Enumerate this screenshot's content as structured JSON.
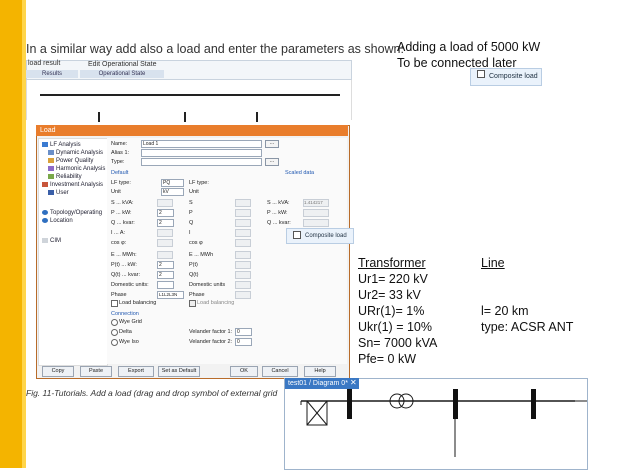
{
  "tutorial": {
    "heading": "In a similar way add also a load and enter the parameters as shown:",
    "mini_toolbar": {
      "result_label": "load result",
      "edit_state_label": "Edit Operational State",
      "tabs": [
        "Results",
        "Operational State"
      ]
    }
  },
  "notes": {
    "line1": "Adding a load of 5000 kW",
    "line2": "To be connected later",
    "composite_load_label": "Composite load"
  },
  "dialog": {
    "title": "Load",
    "tree": [
      "LF Analysis",
      "Dynamic Analysis",
      "Power Quality",
      "Harmonic Analysis",
      "Reliability",
      "Investment Analysis",
      "User",
      "Topology/Operating",
      "Location",
      "CIM"
    ],
    "fields": {
      "name_label": "Name:",
      "name_value": "Load 1",
      "alias_label": "Alias 1:",
      "type_label": "Type:",
      "default_header": "Default",
      "scaled_header": "Scaled data",
      "lf_type_label": "LF type:",
      "lf_type_value": "PQ",
      "unit_label": "Unit",
      "unit_value": "kV",
      "rows_left": [
        "S ... kVA:",
        "P ... kW:",
        "Q ... kvar:",
        "I ... A:",
        "cos φ:",
        "E ... MWh:",
        "P(t) ... kW:",
        "Q(t) ... kvar:",
        "Domestic units:",
        "Phase"
      ],
      "p_value": "2",
      "q_value": "2",
      "p_t_value": "2",
      "q_t_value": "2",
      "phase_value": "L1L2L3N",
      "rows_mid": [
        "S",
        "P",
        "Q",
        "I",
        "cos φ",
        "E ... MWh",
        "P(t)",
        "Q(t)",
        "Domestic units",
        "Phase"
      ],
      "rows_right": [
        "S ... kVA:",
        "P ... kW:",
        "Q ... kvar:"
      ],
      "scaled_value": "1.414217",
      "load_balancing_label": "Load balancing",
      "load_balancing_mid": "Load balancing",
      "connection_header": "Connection",
      "conn_options": [
        "Wye Grid",
        "Delta",
        "Wye Iso"
      ],
      "velander1_label": "Velander factor 1:",
      "velander1_value": "0",
      "velander2_label": "Velander factor 2:",
      "velander2_value": "0"
    },
    "buttons": [
      "Copy",
      "Paste",
      "Export",
      "Set as Default",
      "OK",
      "Cancel",
      "Help"
    ]
  },
  "caption": "Fig. 11-Tutorials.  Add a load (drag and drop symbol of external grid",
  "params": {
    "transformer_header": "Transformer",
    "transformer": [
      "Ur1= 220 kV",
      "Ur2= 33 kV",
      "URr(1)= 1%",
      "Ukr(1) = 10%",
      "Sn= 7000 kVA",
      "Pfe= 0 kW"
    ],
    "line_header": "Line",
    "line": [
      "l= 20 km",
      "type: ACSR ANT"
    ]
  },
  "diagram": {
    "tab_label": "test01 / Diagram 0*",
    "close_glyph": "✕"
  },
  "colors": {
    "accent": "#f4b400",
    "dialog_title": "#e97d2c",
    "diagram_tab": "#3a78c4"
  }
}
